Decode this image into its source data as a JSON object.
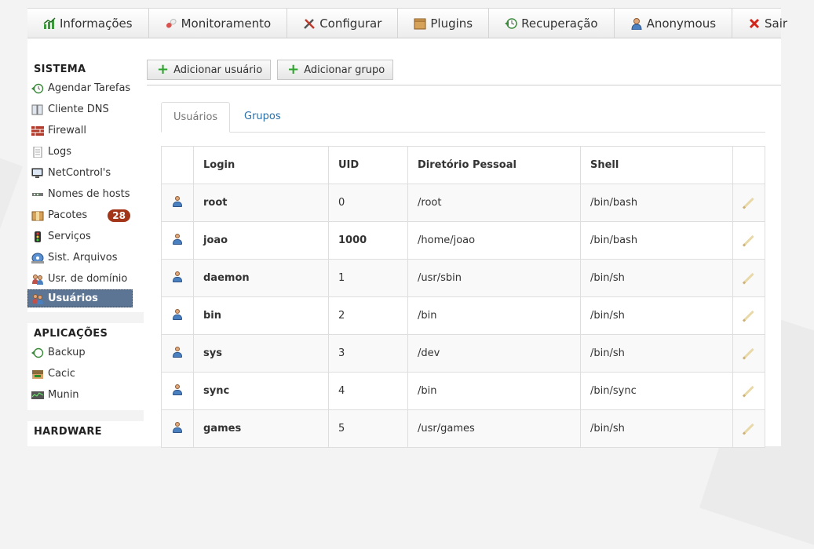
{
  "menu": [
    {
      "label": "Informações",
      "icon": "chart-icon"
    },
    {
      "label": "Monitoramento",
      "icon": "pill-icon"
    },
    {
      "label": "Configurar",
      "icon": "tools-icon"
    },
    {
      "label": "Plugins",
      "icon": "box-icon"
    },
    {
      "label": "Recuperação",
      "icon": "restore-icon"
    },
    {
      "label": "Anonymous",
      "icon": "user-icon"
    },
    {
      "label": "Sair",
      "icon": "close-icon"
    }
  ],
  "sidebar": {
    "sistema": {
      "title": "SISTEMA",
      "items": [
        {
          "label": "Agendar Tarefas",
          "icon": "clock-icon"
        },
        {
          "label": "Cliente DNS",
          "icon": "book-icon"
        },
        {
          "label": "Firewall",
          "icon": "wall-icon"
        },
        {
          "label": "Logs",
          "icon": "document-icon"
        },
        {
          "label": "NetControl's",
          "icon": "monitor-icon"
        },
        {
          "label": "Nomes de hosts",
          "icon": "network-icon"
        },
        {
          "label": "Pacotes",
          "icon": "package-icon",
          "badge": "28"
        },
        {
          "label": "Serviços",
          "icon": "traffic-light-icon"
        },
        {
          "label": "Sist. Arquivos",
          "icon": "disk-icon"
        },
        {
          "label": "Usr. de domínio",
          "icon": "users-icon"
        },
        {
          "label": "Usuários",
          "icon": "users-icon",
          "active": true
        }
      ]
    },
    "aplicacoes": {
      "title": "APLICAÇÕES",
      "items": [
        {
          "label": "Backup",
          "icon": "backup-icon"
        },
        {
          "label": "Cacic",
          "icon": "cacic-icon"
        },
        {
          "label": "Munin",
          "icon": "graph-icon"
        }
      ]
    },
    "hardware": {
      "title": "HARDWARE"
    }
  },
  "actions": {
    "add_user": "Adicionar usuário",
    "add_group": "Adicionar grupo"
  },
  "tabs": {
    "users": "Usuários",
    "groups": "Grupos"
  },
  "table": {
    "headers": {
      "login": "Login",
      "uid": "UID",
      "home": "Diretório Pessoal",
      "shell": "Shell"
    },
    "rows": [
      {
        "login": "root",
        "uid": "0",
        "home": "/root",
        "shell": "/bin/bash"
      },
      {
        "login": "joao",
        "uid": "1000",
        "home": "/home/joao",
        "shell": "/bin/bash"
      },
      {
        "login": "daemon",
        "uid": "1",
        "home": "/usr/sbin",
        "shell": "/bin/sh"
      },
      {
        "login": "bin",
        "uid": "2",
        "home": "/bin",
        "shell": "/bin/sh"
      },
      {
        "login": "sys",
        "uid": "3",
        "home": "/dev",
        "shell": "/bin/sh"
      },
      {
        "login": "sync",
        "uid": "4",
        "home": "/bin",
        "shell": "/bin/sync"
      },
      {
        "login": "games",
        "uid": "5",
        "home": "/usr/games",
        "shell": "/bin/sh"
      }
    ]
  },
  "colors": {
    "active_bg": "#5c7595",
    "badge_bg": "#a33519",
    "link": "#2a6fa8",
    "plus": "#2ea22e"
  }
}
